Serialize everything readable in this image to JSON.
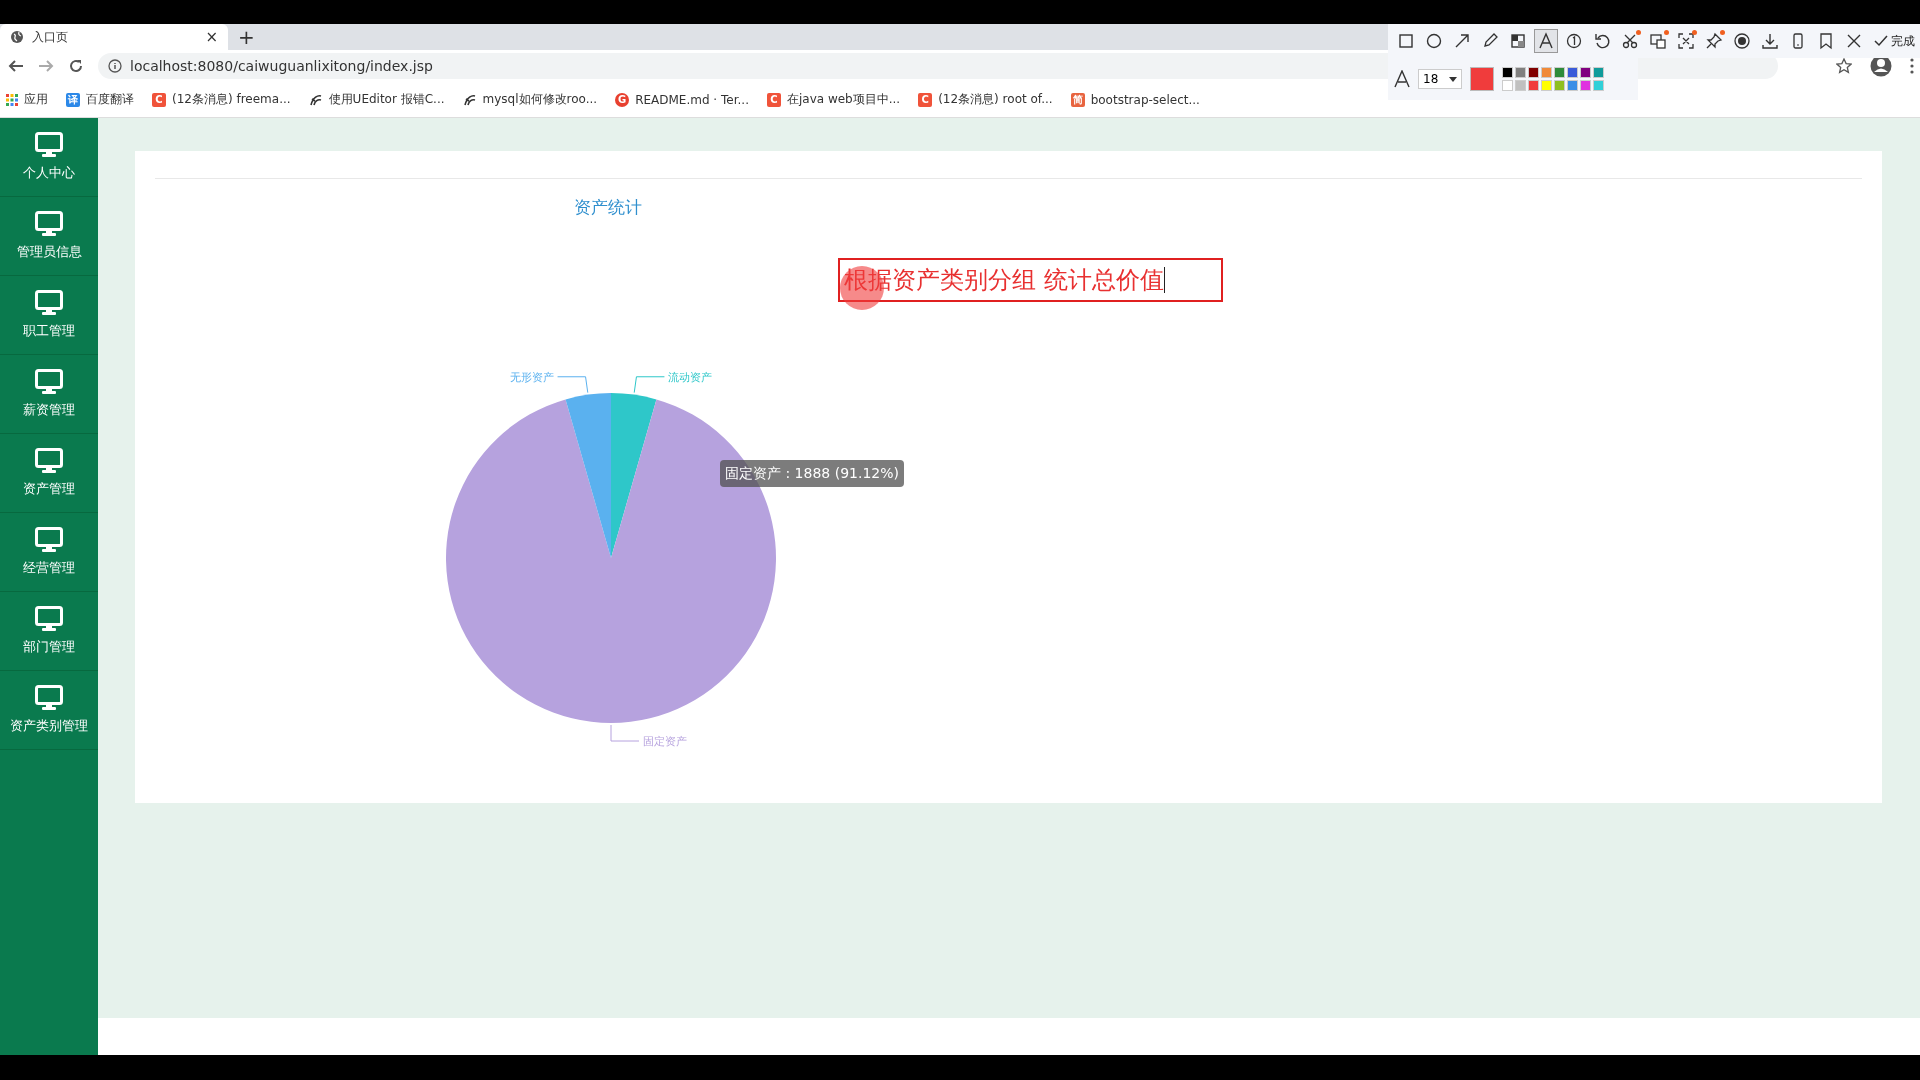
{
  "browser": {
    "tab": {
      "title": "入口页",
      "close": "×"
    },
    "new_tab": "+",
    "url": "localhost:8080/caiwuguanlixitong/index.jsp",
    "bookmarks": [
      {
        "kind": "apps",
        "label": "应用"
      },
      {
        "kind": "badge",
        "icon_text": "译",
        "color": "#2b88e8",
        "label": "百度翻译"
      },
      {
        "kind": "badge",
        "icon_text": "C",
        "color": "#f0533a",
        "label": "(12条消息) freema..."
      },
      {
        "kind": "swirl",
        "label": "使用UEditor 报错C..."
      },
      {
        "kind": "swirl",
        "label": "mysql如何修改roo..."
      },
      {
        "kind": "round",
        "icon_text": "G",
        "color": "#e8402f",
        "label": "README.md · Ter..."
      },
      {
        "kind": "badge",
        "icon_text": "C",
        "color": "#f0533a",
        "label": "在java web项目中..."
      },
      {
        "kind": "badge",
        "icon_text": "C",
        "color": "#f0533a",
        "label": "(12条消息) root of..."
      },
      {
        "kind": "badge",
        "icon_text": "简",
        "color": "#e8643f",
        "label": "bootstrap-select..."
      }
    ]
  },
  "annotation_toolbar": {
    "tools": [
      {
        "kind": "rect",
        "selected": false,
        "new": false
      },
      {
        "kind": "ellipse",
        "selected": false,
        "new": false
      },
      {
        "kind": "arrow",
        "selected": false,
        "new": false
      },
      {
        "kind": "pencil",
        "selected": false,
        "new": false
      },
      {
        "kind": "mosaic",
        "selected": false,
        "new": false
      },
      {
        "kind": "text",
        "selected": true,
        "new": false
      },
      {
        "kind": "number",
        "selected": false,
        "new": false
      },
      {
        "kind": "undo",
        "selected": false,
        "new": false
      },
      {
        "kind": "scissors",
        "selected": false,
        "new": true
      },
      {
        "kind": "ocr",
        "selected": false,
        "new": true
      },
      {
        "kind": "region",
        "selected": false,
        "new": true
      },
      {
        "kind": "pin",
        "selected": false,
        "new": true
      },
      {
        "kind": "record",
        "selected": false,
        "new": false
      },
      {
        "kind": "download",
        "selected": false,
        "new": false
      },
      {
        "kind": "phone",
        "selected": false,
        "new": false
      },
      {
        "kind": "bookmark",
        "selected": false,
        "new": false
      },
      {
        "kind": "close",
        "selected": false,
        "new": false
      }
    ],
    "done": "完成",
    "font_size": "18",
    "current": {
      "color": "#f03c3c"
    },
    "palette": [
      {
        "color": "#000000"
      },
      {
        "color": "#808080"
      },
      {
        "color": "#800000"
      },
      {
        "color": "#f08a3a"
      },
      {
        "color": "#2e8b3a"
      },
      {
        "color": "#3a5bd9"
      },
      {
        "color": "#800080"
      },
      {
        "color": "#0f9b9b"
      },
      {
        "color": "#ffffff"
      },
      {
        "color": "#c0c0c0"
      },
      {
        "color": "#f03c3c"
      },
      {
        "color": "#ffff00"
      },
      {
        "color": "#8fbf1f"
      },
      {
        "color": "#3a8ee6"
      },
      {
        "color": "#e030e0"
      },
      {
        "color": "#30d0d8"
      }
    ]
  },
  "sidebar": {
    "items": [
      {
        "label": "个人中心"
      },
      {
        "label": "管理员信息"
      },
      {
        "label": "职工管理"
      },
      {
        "label": "薪资管理"
      },
      {
        "label": "资产管理"
      },
      {
        "label": "经营管理"
      },
      {
        "label": "部门管理"
      },
      {
        "label": "资产类别管理"
      }
    ]
  },
  "panel": {
    "chart_data": {
      "type": "pie",
      "title": "资产统计",
      "categories": [
        "流动资产",
        "固定资产",
        "无形资产"
      ],
      "colors": [
        "#2ec7c9",
        "#b6a2de",
        "#5ab1ef"
      ],
      "series": [
        {
          "values": [
            4.44,
            91.12,
            4.44
          ]
        }
      ]
    },
    "tooltip": "固定资产 : 1888 (91.12%)"
  },
  "annotation": {
    "text": "根据资产类别分组 统计总价值"
  }
}
